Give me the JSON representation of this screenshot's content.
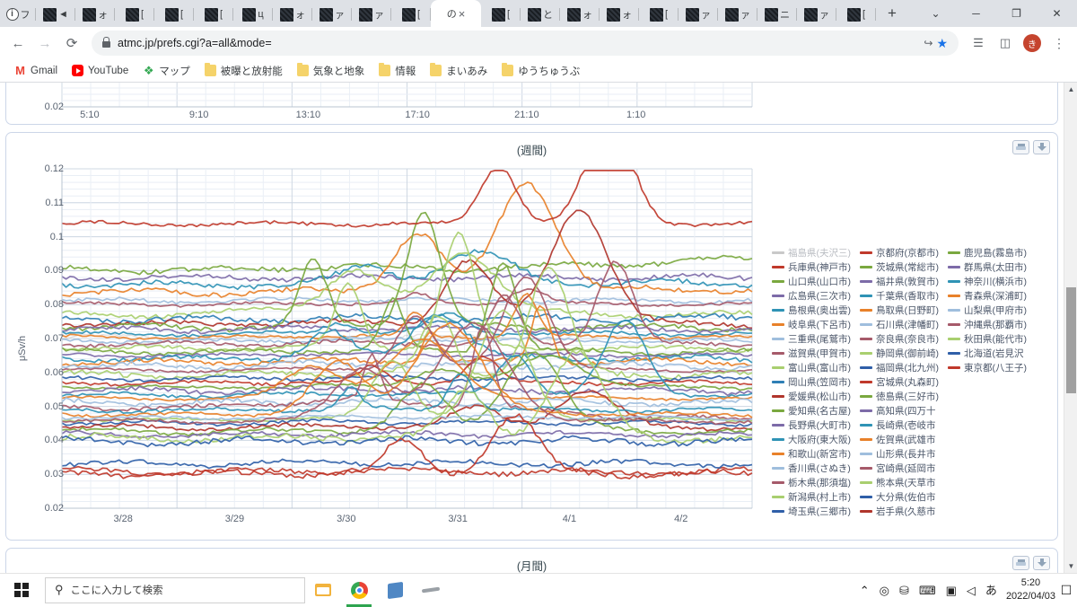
{
  "browser": {
    "tabs": [
      {
        "icon": "info-favicon",
        "char": "フ",
        "active": false
      },
      {
        "icon": "site-favicon",
        "char": "◄",
        "active": false
      },
      {
        "icon": "site-favicon",
        "char": "ォ",
        "active": false
      },
      {
        "icon": "site-favicon",
        "char": "[",
        "active": false
      },
      {
        "icon": "site-favicon",
        "char": "[",
        "active": false
      },
      {
        "icon": "site-favicon",
        "char": "[",
        "active": false
      },
      {
        "icon": "site-favicon",
        "char": "ц",
        "active": false
      },
      {
        "icon": "site-favicon",
        "char": "ォ",
        "active": false
      },
      {
        "icon": "site-favicon",
        "char": "ァ",
        "active": false
      },
      {
        "icon": "site-favicon",
        "char": "ァ",
        "active": false
      },
      {
        "icon": "site-favicon",
        "char": "[",
        "active": false
      },
      {
        "icon": "none",
        "char": "の",
        "active": true
      },
      {
        "icon": "site-favicon",
        "char": "[",
        "active": false
      },
      {
        "icon": "site-favicon",
        "char": "と",
        "active": false
      },
      {
        "icon": "site-favicon",
        "char": "ォ",
        "active": false
      },
      {
        "icon": "site-favicon",
        "char": "ォ",
        "active": false
      },
      {
        "icon": "site-favicon",
        "char": "[",
        "active": false
      },
      {
        "icon": "site-favicon",
        "char": "ァ",
        "active": false
      },
      {
        "icon": "site-favicon",
        "char": "ァ",
        "active": false
      },
      {
        "icon": "site-favicon",
        "char": "ニ",
        "active": false
      },
      {
        "icon": "site-favicon",
        "char": "ァ",
        "active": false
      },
      {
        "icon": "site-favicon",
        "char": "[",
        "active": false
      }
    ],
    "new_tab_label": "+",
    "tab_close_label": "×",
    "tab_search_label": "⌄",
    "window_minimize": "─",
    "window_maximize": "❐",
    "window_close": "✕",
    "nav": {
      "back": "←",
      "forward": "→",
      "reload": "⟳"
    },
    "omnibox": {
      "url": "atmc.jp/prefs.cgi?a=all&mode=",
      "placeholder": "検索または URL を入力",
      "lock_icon": "lock-icon",
      "share_icon": "share-icon",
      "bookmark_star_icon": "star-icon",
      "reading_list_icon": "reading-list-icon",
      "side_panel_icon": "side-panel-icon",
      "profile_initial": "き",
      "menu_icon": "three-dot-menu-icon"
    },
    "bookmarks": [
      {
        "icon": "gmail-icon",
        "label": "Gmail",
        "glyph": "M"
      },
      {
        "icon": "youtube-icon",
        "label": "YouTube",
        "glyph": ""
      },
      {
        "icon": "maps-pin-icon",
        "label": "マップ",
        "glyph": "❖"
      },
      {
        "icon": "folder-icon",
        "label": "被曝と放射能",
        "glyph": ""
      },
      {
        "icon": "folder-icon",
        "label": "気象と地象",
        "glyph": ""
      },
      {
        "icon": "folder-icon",
        "label": "情報",
        "glyph": ""
      },
      {
        "icon": "folder-icon",
        "label": "まいあみ",
        "glyph": ""
      },
      {
        "icon": "folder-icon",
        "label": "ゆうちゅうぶ",
        "glyph": ""
      }
    ]
  },
  "page": {
    "card_top": {
      "ytick": "0.02",
      "xticks": [
        "5:10",
        "9:10",
        "13:10",
        "17:10",
        "21:10",
        "1:10"
      ]
    },
    "card_main": {
      "title": "(週間)",
      "print_tool": "print-icon",
      "download_tool": "download-icon",
      "ylabel": "μSv/h",
      "yticks": [
        "0.12",
        "0.11",
        "0.1",
        "0.09",
        "0.08",
        "0.07",
        "0.06",
        "0.05",
        "0.04",
        "0.03",
        "0.02"
      ],
      "xticks": [
        "3/28",
        "3/29",
        "3/30",
        "3/31",
        "4/1",
        "4/2"
      ]
    },
    "card_bottom": {
      "title": "(月間)",
      "print_tool": "print-icon",
      "download_tool": "download-icon"
    }
  },
  "chart_data": {
    "type": "line",
    "title": "(週間)",
    "xlabel": "",
    "ylabel": "μSv/h",
    "ylim": [
      0.02,
      0.12
    ],
    "ytick_values": [
      0.12,
      0.11,
      0.1,
      0.09,
      0.08,
      0.07,
      0.06,
      0.05,
      0.04,
      0.03,
      0.02
    ],
    "x": [
      "3/28",
      "3/29",
      "3/30",
      "3/31",
      "4/1",
      "4/2"
    ],
    "grid": true,
    "legend_position": "right",
    "series": [
      {
        "name": "福島県(夫沢三)",
        "color": "#c9c9c9",
        "muted": true,
        "values": [
          0.0705,
          0.0705,
          0.07,
          0.0705,
          0.07,
          0.0705
        ]
      },
      {
        "name": "兵庫県(神戸市)",
        "color": "#c0392b",
        "values": [
          0.031,
          0.0305,
          0.0312,
          0.0308,
          0.0305,
          0.031
        ]
      },
      {
        "name": "山口県(山口市)",
        "color": "#7aa83f",
        "values": [
          0.0905,
          0.09,
          0.0912,
          0.0905,
          0.092,
          0.0935
        ]
      },
      {
        "name": "広島県(三次市)",
        "color": "#7d6ba8",
        "values": [
          0.088,
          0.088,
          0.0878,
          0.088,
          0.088,
          0.088
        ]
      },
      {
        "name": "島根県(奥出雲)",
        "color": "#2f93b5",
        "values": [
          0.0862,
          0.0858,
          0.086,
          0.0862,
          0.0865,
          0.0862
        ]
      },
      {
        "name": "岐阜県(下呂市)",
        "color": "#e8812a",
        "values": [
          0.0838,
          0.0835,
          0.084,
          0.0838,
          0.0842,
          0.0845
        ]
      },
      {
        "name": "三重県(尾鷲市)",
        "color": "#9fbedd",
        "values": [
          0.0812,
          0.081,
          0.0815,
          0.0812,
          0.0812,
          0.081
        ]
      },
      {
        "name": "滋賀県(甲賀市)",
        "color": "#a65a6a",
        "values": [
          0.0802,
          0.08,
          0.0805,
          0.0802,
          0.0802,
          0.08
        ]
      },
      {
        "name": "富山県(富山市)",
        "color": "#a9cf6f",
        "values": [
          0.0772,
          0.077,
          0.0805,
          0.0775,
          0.0772,
          0.077
        ]
      },
      {
        "name": "岡山県(笠岡市)",
        "color": "#2f7fb5",
        "values": [
          0.0758,
          0.0755,
          0.076,
          0.0758,
          0.0758,
          0.076
        ]
      },
      {
        "name": "愛媛県(松山市)",
        "color": "#b0352c",
        "values": [
          0.0745,
          0.0742,
          0.0748,
          0.0745,
          0.0745,
          0.0742
        ]
      },
      {
        "name": "愛知県(名古屋)",
        "color": "#7aa83f",
        "values": [
          0.0735,
          0.0732,
          0.0738,
          0.0735,
          0.0735,
          0.0732
        ]
      },
      {
        "name": "長野県(大町市)",
        "color": "#7d6ba8",
        "values": [
          0.0728,
          0.0725,
          0.073,
          0.0728,
          0.0728,
          0.0725
        ]
      },
      {
        "name": "大阪府(東大阪)",
        "color": "#2f93b5",
        "values": [
          0.0715,
          0.0712,
          0.0718,
          0.0715,
          0.0715,
          0.0712
        ]
      },
      {
        "name": "和歌山(新宮市)",
        "color": "#e8812a",
        "values": [
          0.0705,
          0.0702,
          0.0708,
          0.0705,
          0.0705,
          0.0702
        ]
      },
      {
        "name": "香川県(さぬき)",
        "color": "#9fbedd",
        "values": [
          0.0695,
          0.0692,
          0.0698,
          0.0695,
          0.0695,
          0.0692
        ]
      },
      {
        "name": "栃木県(那須塩)",
        "color": "#a65a6a",
        "values": [
          0.0685,
          0.0682,
          0.0688,
          0.0685,
          0.0685,
          0.0682
        ]
      },
      {
        "name": "新潟県(村上市)",
        "color": "#a9cf6f",
        "values": [
          0.0672,
          0.067,
          0.0675,
          0.0672,
          0.0672,
          0.067
        ]
      },
      {
        "name": "埼玉県(三郷市)",
        "color": "#2f5fa8",
        "values": [
          0.0332,
          0.033,
          0.0335,
          0.0332,
          0.0332,
          0.033
        ]
      },
      {
        "name": "京都府(京都市)",
        "color": "#c0392b",
        "values": [
          0.1038,
          0.1038,
          0.1038,
          0.1038,
          0.1038,
          0.1038
        ]
      },
      {
        "name": "茨城県(常総市)",
        "color": "#7aa83f",
        "values": [
          0.0662,
          0.066,
          0.0665,
          0.0662,
          0.0662,
          0.066
        ]
      },
      {
        "name": "福井県(敦賀市)",
        "color": "#7d6ba8",
        "values": [
          0.0652,
          0.065,
          0.0655,
          0.0652,
          0.0652,
          0.065
        ]
      },
      {
        "name": "千葉県(香取市)",
        "color": "#2f93b5",
        "values": [
          0.0642,
          0.064,
          0.0645,
          0.0642,
          0.0642,
          0.064
        ]
      },
      {
        "name": "鳥取県(日野町)",
        "color": "#e8812a",
        "values": [
          0.0632,
          0.063,
          0.0635,
          0.0632,
          0.0632,
          0.063
        ]
      },
      {
        "name": "石川県(津幡町)",
        "color": "#9fbedd",
        "values": [
          0.062,
          0.0618,
          0.0625,
          0.062,
          0.062,
          0.0618
        ]
      },
      {
        "name": "奈良県(奈良市)",
        "color": "#a65a6a",
        "values": [
          0.0608,
          0.0605,
          0.0612,
          0.0608,
          0.0608,
          0.0605
        ]
      },
      {
        "name": "静岡県(御前崎)",
        "color": "#a9cf6f",
        "values": [
          0.0595,
          0.0592,
          0.0598,
          0.0595,
          0.0595,
          0.0592
        ]
      },
      {
        "name": "福岡県(北九州)",
        "color": "#2f5fa8",
        "values": [
          0.0582,
          0.058,
          0.0585,
          0.0582,
          0.0582,
          0.058
        ]
      },
      {
        "name": "宮城県(丸森町)",
        "color": "#c0392b",
        "values": [
          0.057,
          0.0568,
          0.0572,
          0.057,
          0.057,
          0.0568
        ]
      },
      {
        "name": "徳島県(三好市)",
        "color": "#7aa83f",
        "values": [
          0.0558,
          0.0555,
          0.056,
          0.0558,
          0.0558,
          0.0555
        ]
      },
      {
        "name": "高知県(四万十",
        "color": "#7d6ba8",
        "values": [
          0.0548,
          0.0545,
          0.055,
          0.0548,
          0.0548,
          0.0545
        ]
      },
      {
        "name": "長崎県(壱岐市",
        "color": "#2f93b5",
        "values": [
          0.0535,
          0.0532,
          0.0538,
          0.0535,
          0.0535,
          0.0532
        ]
      },
      {
        "name": "佐賀県(武雄市",
        "color": "#e8812a",
        "values": [
          0.0525,
          0.0522,
          0.0528,
          0.0525,
          0.0525,
          0.0522
        ]
      },
      {
        "name": "山形県(長井市",
        "color": "#9fbedd",
        "values": [
          0.0512,
          0.051,
          0.0515,
          0.0512,
          0.0512,
          0.051
        ]
      },
      {
        "name": "宮崎県(延岡市",
        "color": "#a65a6a",
        "values": [
          0.0498,
          0.0495,
          0.052,
          0.05,
          0.047,
          0.0462
        ]
      },
      {
        "name": "熊本県(天草市",
        "color": "#a9cf6f",
        "values": [
          0.0462,
          0.046,
          0.0465,
          0.0462,
          0.0462,
          0.046
        ]
      },
      {
        "name": "大分県(佐伯市",
        "color": "#2f5fa8",
        "values": [
          0.0452,
          0.045,
          0.0455,
          0.0452,
          0.0452,
          0.045
        ]
      },
      {
        "name": "岩手県(久慈市",
        "color": "#b0352c",
        "values": [
          0.044,
          0.0438,
          0.0442,
          0.044,
          0.044,
          0.0438
        ]
      },
      {
        "name": "鹿児島(霧島市)",
        "color": "#7aa83f",
        "values": [
          0.0428,
          0.0425,
          0.043,
          0.0428,
          0.0428,
          0.0425
        ]
      },
      {
        "name": "群馬県(太田市)",
        "color": "#7d6ba8",
        "values": [
          0.0418,
          0.0415,
          0.042,
          0.0418,
          0.0418,
          0.0415
        ]
      },
      {
        "name": "神奈川(横浜市)",
        "color": "#2f93b5",
        "values": [
          0.049,
          0.0488,
          0.0492,
          0.049,
          0.049,
          0.0488
        ]
      },
      {
        "name": "青森県(深浦町)",
        "color": "#e8812a",
        "values": [
          0.0478,
          0.0475,
          0.048,
          0.0478,
          0.0478,
          0.0475
        ]
      },
      {
        "name": "山梨県(甲府市)",
        "color": "#9fbedd",
        "values": [
          0.0468,
          0.0465,
          0.047,
          0.0468,
          0.0468,
          0.0465
        ]
      },
      {
        "name": "沖縄県(那覇市)",
        "color": "#a65a6a",
        "values": [
          0.0458,
          0.0455,
          0.046,
          0.0458,
          0.0458,
          0.0455
        ]
      },
      {
        "name": "秋田県(能代市)",
        "color": "#a9cf6f",
        "values": [
          0.0408,
          0.0405,
          0.041,
          0.0408,
          0.0408,
          0.0405
        ]
      },
      {
        "name": "北海道(岩見沢",
        "color": "#2f5fa8",
        "values": [
          0.0398,
          0.0395,
          0.04,
          0.0398,
          0.0398,
          0.0395
        ]
      },
      {
        "name": "東京都(八王子)",
        "color": "#c0392b",
        "values": [
          0.0302,
          0.03,
          0.0305,
          0.0302,
          0.0302,
          0.03
        ]
      }
    ]
  },
  "scrollbar": {
    "up": "▲",
    "down": "▼"
  },
  "taskbar": {
    "start_icon": "windows-start-icon",
    "search_placeholder": "ここに入力して検索",
    "search_icon": "search-icon",
    "apps": [
      {
        "name": "file-explorer-icon"
      },
      {
        "name": "chrome-icon",
        "active": true
      },
      {
        "name": "store-icon"
      },
      {
        "name": "pen-icon"
      }
    ],
    "tray": [
      {
        "name": "chevron-up-icon",
        "glyph": "⌃"
      },
      {
        "name": "camera-icon",
        "glyph": "◎"
      },
      {
        "name": "usb-icon",
        "glyph": "⛁"
      },
      {
        "name": "display-icon",
        "glyph": "⌨"
      },
      {
        "name": "network-icon",
        "glyph": "▣"
      },
      {
        "name": "volume-icon",
        "glyph": "◁"
      },
      {
        "name": "ime-icon",
        "glyph": "あ"
      }
    ],
    "clock_time": "5:20",
    "clock_date": "2022/04/03",
    "notification_icon": "notification-icon"
  }
}
